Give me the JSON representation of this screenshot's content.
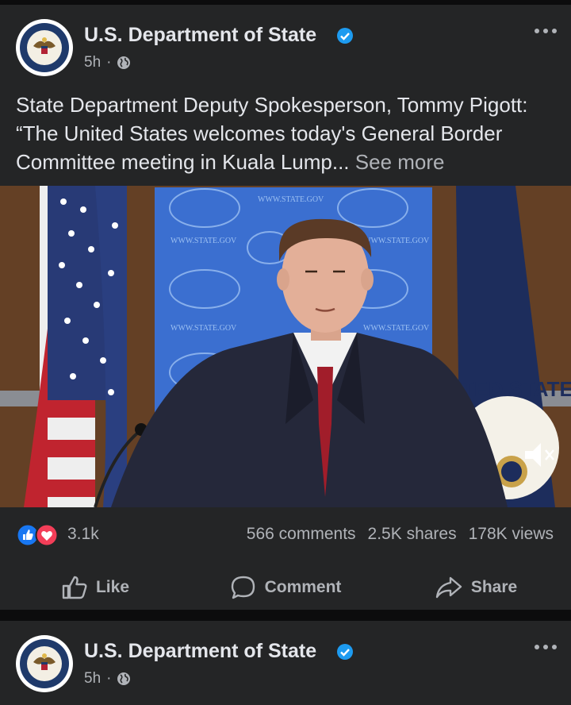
{
  "posts": [
    {
      "page_name": "U.S. Department of State",
      "time": "5h",
      "separator": "·",
      "text": "State Department Deputy Spokesperson, Tommy Pigott: “The United States welcomes today's General Border Committee meeting in Kuala Lump...",
      "see_more": "See more",
      "media": {
        "backdrop_text": "WWW.STATE.GOV",
        "seal_text": "ITED STATES"
      },
      "reaction_count": "3.1k",
      "comments": "566 comments",
      "shares": "2.5K shares",
      "views": "178K views",
      "actions": {
        "like": "Like",
        "comment": "Comment",
        "share": "Share"
      }
    },
    {
      "page_name": "U.S. Department of State",
      "time": "5h",
      "separator": "·"
    }
  ],
  "colors": {
    "background": "#0c0c0d",
    "card": "#242526",
    "text_primary": "#e4e6eb",
    "text_secondary": "#b0b3b8",
    "verified_blue": "#1d9bf0",
    "like_blue": "#1877f2",
    "love_red": "#f33e58"
  },
  "icons": [
    "state-seal-icon",
    "verified-badge-icon",
    "globe-icon",
    "more-options-icon",
    "like-reaction-icon",
    "love-reaction-icon",
    "like-icon",
    "comment-icon",
    "share-icon",
    "mute-icon"
  ]
}
